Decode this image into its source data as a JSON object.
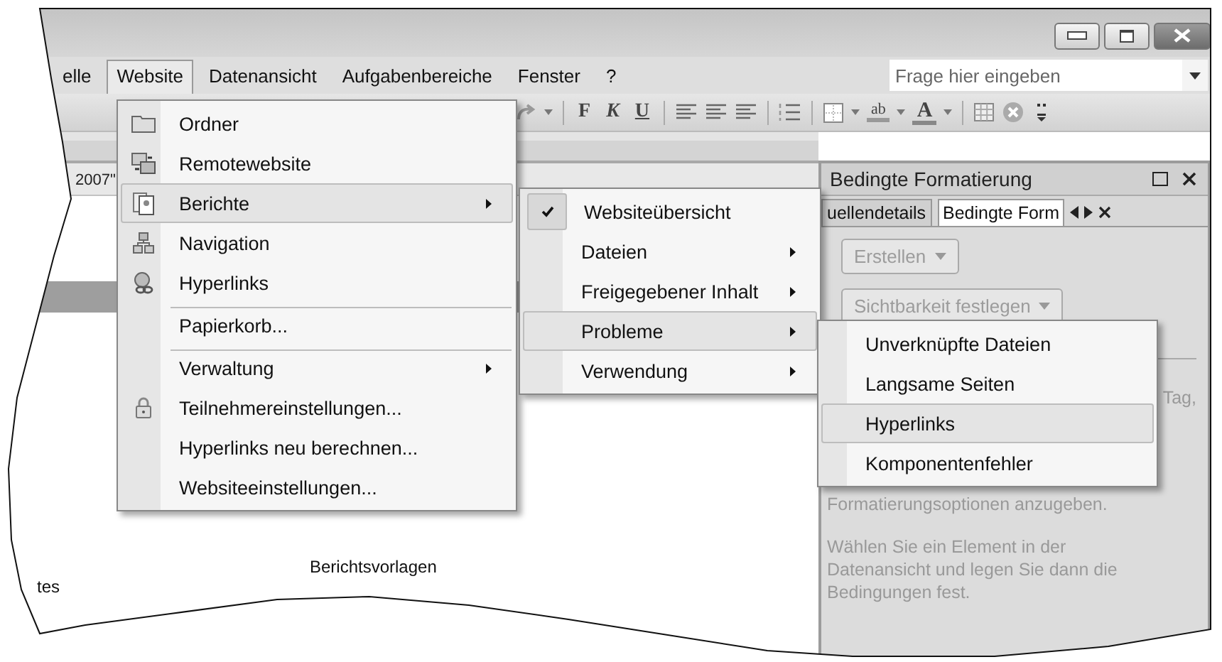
{
  "window": {
    "buttons": [
      {
        "kind": "minimize"
      },
      {
        "kind": "restore"
      },
      {
        "kind": "close"
      }
    ]
  },
  "menubar": {
    "items": [
      {
        "label": "elle",
        "selected": false
      },
      {
        "label": "Website",
        "selected": true
      },
      {
        "label": "Datenansicht",
        "selected": false
      },
      {
        "label": "Aufgabenbereiche",
        "selected": false
      },
      {
        "label": "Fenster",
        "selected": false
      },
      {
        "label": "?",
        "selected": false
      }
    ],
    "search": {
      "placeholder": "Frage hier eingeben"
    }
  },
  "toolbar": [
    {
      "kind": "redo"
    },
    {
      "kind": "caret"
    },
    {
      "kind": "sep"
    },
    {
      "kind": "bold",
      "label": "F"
    },
    {
      "kind": "italic",
      "label": "K"
    },
    {
      "kind": "underline",
      "label": "U"
    },
    {
      "kind": "sep"
    },
    {
      "kind": "align"
    },
    {
      "kind": "align"
    },
    {
      "kind": "align"
    },
    {
      "kind": "sep"
    },
    {
      "kind": "list"
    },
    {
      "kind": "sep"
    },
    {
      "kind": "border"
    },
    {
      "kind": "caret"
    },
    {
      "kind": "highlight",
      "label": "ab"
    },
    {
      "kind": "caret"
    },
    {
      "kind": "fontcolor",
      "label": "A"
    },
    {
      "kind": "caret"
    },
    {
      "kind": "sep"
    },
    {
      "kind": "table"
    },
    {
      "kind": "stop"
    },
    {
      "kind": "overflow"
    }
  ],
  "document": {
    "tab_fragment": "2007\"",
    "caption": "Berichtsvorlagen",
    "fragment": "tes"
  },
  "website_menu": [
    {
      "label": "Ordner",
      "kind": "folder",
      "submenu": false,
      "selected": false,
      "separator_before": false
    },
    {
      "label": "Remotewebsite",
      "kind": "remote",
      "submenu": false,
      "selected": false,
      "separator_before": false
    },
    {
      "label": "Berichte",
      "kind": "reports",
      "submenu": true,
      "selected": true,
      "separator_before": false
    },
    {
      "label": "Navigation",
      "kind": "navigation",
      "submenu": false,
      "selected": false,
      "separator_before": false
    },
    {
      "label": "Hyperlinks",
      "kind": "hyperlinks",
      "submenu": false,
      "selected": false,
      "separator_before": false
    },
    {
      "label": "Papierkorb...",
      "kind": "plain",
      "submenu": false,
      "selected": false,
      "separator_before": true
    },
    {
      "label": "Verwaltung",
      "kind": "plain",
      "submenu": true,
      "selected": false,
      "separator_before": true
    },
    {
      "label": "Teilnehmereinstellungen...",
      "kind": "lock",
      "submenu": false,
      "selected": false,
      "separator_before": false
    },
    {
      "label": "Hyperlinks neu berechnen...",
      "kind": "plain",
      "submenu": false,
      "selected": false,
      "separator_before": false
    },
    {
      "label": "Websiteeinstellungen...",
      "kind": "plain",
      "submenu": false,
      "selected": false,
      "separator_before": false
    }
  ],
  "reports_menu": [
    {
      "label": "Websiteübersicht",
      "checked": true,
      "submenu": false,
      "selected": false
    },
    {
      "label": "Dateien",
      "checked": false,
      "submenu": true,
      "selected": false
    },
    {
      "label": "Freigegebener Inhalt",
      "checked": false,
      "submenu": true,
      "selected": false
    },
    {
      "label": "Probleme",
      "checked": false,
      "submenu": true,
      "selected": true
    },
    {
      "label": "Verwendung",
      "checked": false,
      "submenu": true,
      "selected": false
    }
  ],
  "problems_menu": [
    {
      "label": "Unverknüpfte Dateien",
      "selected": false
    },
    {
      "label": "Langsame Seiten",
      "selected": false
    },
    {
      "label": "Hyperlinks",
      "selected": true
    },
    {
      "label": "Komponentenfehler",
      "selected": false
    }
  ],
  "panel": {
    "title": "Bedingte Formatierung",
    "tabs": [
      {
        "label": "uellendetails",
        "selected": false
      },
      {
        "label": "Bedingte Form",
        "selected": true
      }
    ],
    "buttons": [
      {
        "label": "Erstellen",
        "disabled": true
      },
      {
        "label": "Sichtbarkeit festlegen",
        "disabled": true
      }
    ],
    "fragment": "Tag,",
    "texts": [
      "Formatierungsoptionen anzugeben.",
      "Wählen Sie ein Element in der Datenansicht und legen Sie dann die Bedingungen fest."
    ]
  }
}
